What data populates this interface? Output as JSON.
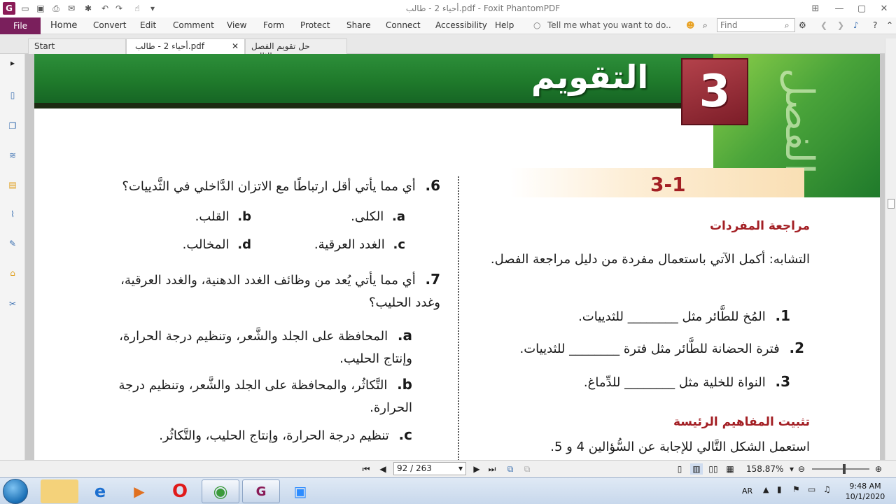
{
  "window": {
    "title": "أحياء 2 - طالب.pdf - Foxit PhantomPDF",
    "app_logo": "G"
  },
  "menu": {
    "file": "File",
    "items": [
      "Home",
      "Convert",
      "Edit",
      "Comment",
      "View",
      "Form",
      "Protect",
      "Share",
      "Connect",
      "Accessibility",
      "Help"
    ],
    "tell_me": "Tell me what you want to do..",
    "find_placeholder": "Find"
  },
  "tabs": [
    {
      "label": "Start",
      "active": false
    },
    {
      "label": "أحياء 2 - طالب.pdf",
      "active": true
    },
    {
      "label": "حل تقويم الفصل الثالث...",
      "active": false
    }
  ],
  "document": {
    "banner_title": "التقويم",
    "chapter_number": "3",
    "chapter_label": "الفصل",
    "section_number": "3-1",
    "vocab_heading": "مراجعة المفردات",
    "vocab_intro": "التشابه: أكمل الآتي باستعمال مفردة من دليل مراجعة الفصل.",
    "vocab_items": [
      {
        "num": "1.",
        "text": "المُخ للطَّائر مثل ________ للثدييات."
      },
      {
        "num": "2.",
        "text": "فترة الحضانة للطَّائر مثل فترة ________ للثدييات."
      },
      {
        "num": "3.",
        "text": "النواة للخلية مثل ________ للدِّماغ."
      }
    ],
    "concepts_heading": "تثبيت المفاهيم الرئيسة",
    "concepts_intro": "استعمل الشكل التَّالي للإجابة عن السُّؤالين 4 و 5.",
    "q6": {
      "num": "6.",
      "text": "أي مما يأتي أقل ارتباطًا مع الاتزان الدَّاخلي في الثَّدييات؟",
      "options": [
        {
          "letter": "a.",
          "text": "الكلى."
        },
        {
          "letter": "b.",
          "text": "القلب."
        },
        {
          "letter": "c.",
          "text": "الغدد العرقية."
        },
        {
          "letter": "d.",
          "text": "المخالب."
        }
      ]
    },
    "q7": {
      "num": "7.",
      "text": "أي مما يأتي يُعد من وظائف الغدد الدهنية، والغدد العرقية، وغدد الحليب؟",
      "options": [
        {
          "letter": "a.",
          "text": "المحافظة على الجلد والشَّعر، وتنظيم درجة الحرارة، وإنتاج الحليب."
        },
        {
          "letter": "b.",
          "text": "التَّكاثُر، والمحافظة على الجلد والشَّعر، وتنظيم درجة الحرارة."
        },
        {
          "letter": "c.",
          "text": "تنظيم درجة الحرارة، وإنتاج الحليب، والتَّكاثُر."
        }
      ]
    }
  },
  "navigation": {
    "page": "92 / 263",
    "zoom": "158.87%"
  },
  "taskbar": {
    "language": "AR",
    "time": "9:48 AM",
    "date": "10/1/2020"
  },
  "colors": {
    "file_tab": "#7a1f5c",
    "banner_green": "#1f7a2b",
    "heading_red": "#a31f24"
  }
}
